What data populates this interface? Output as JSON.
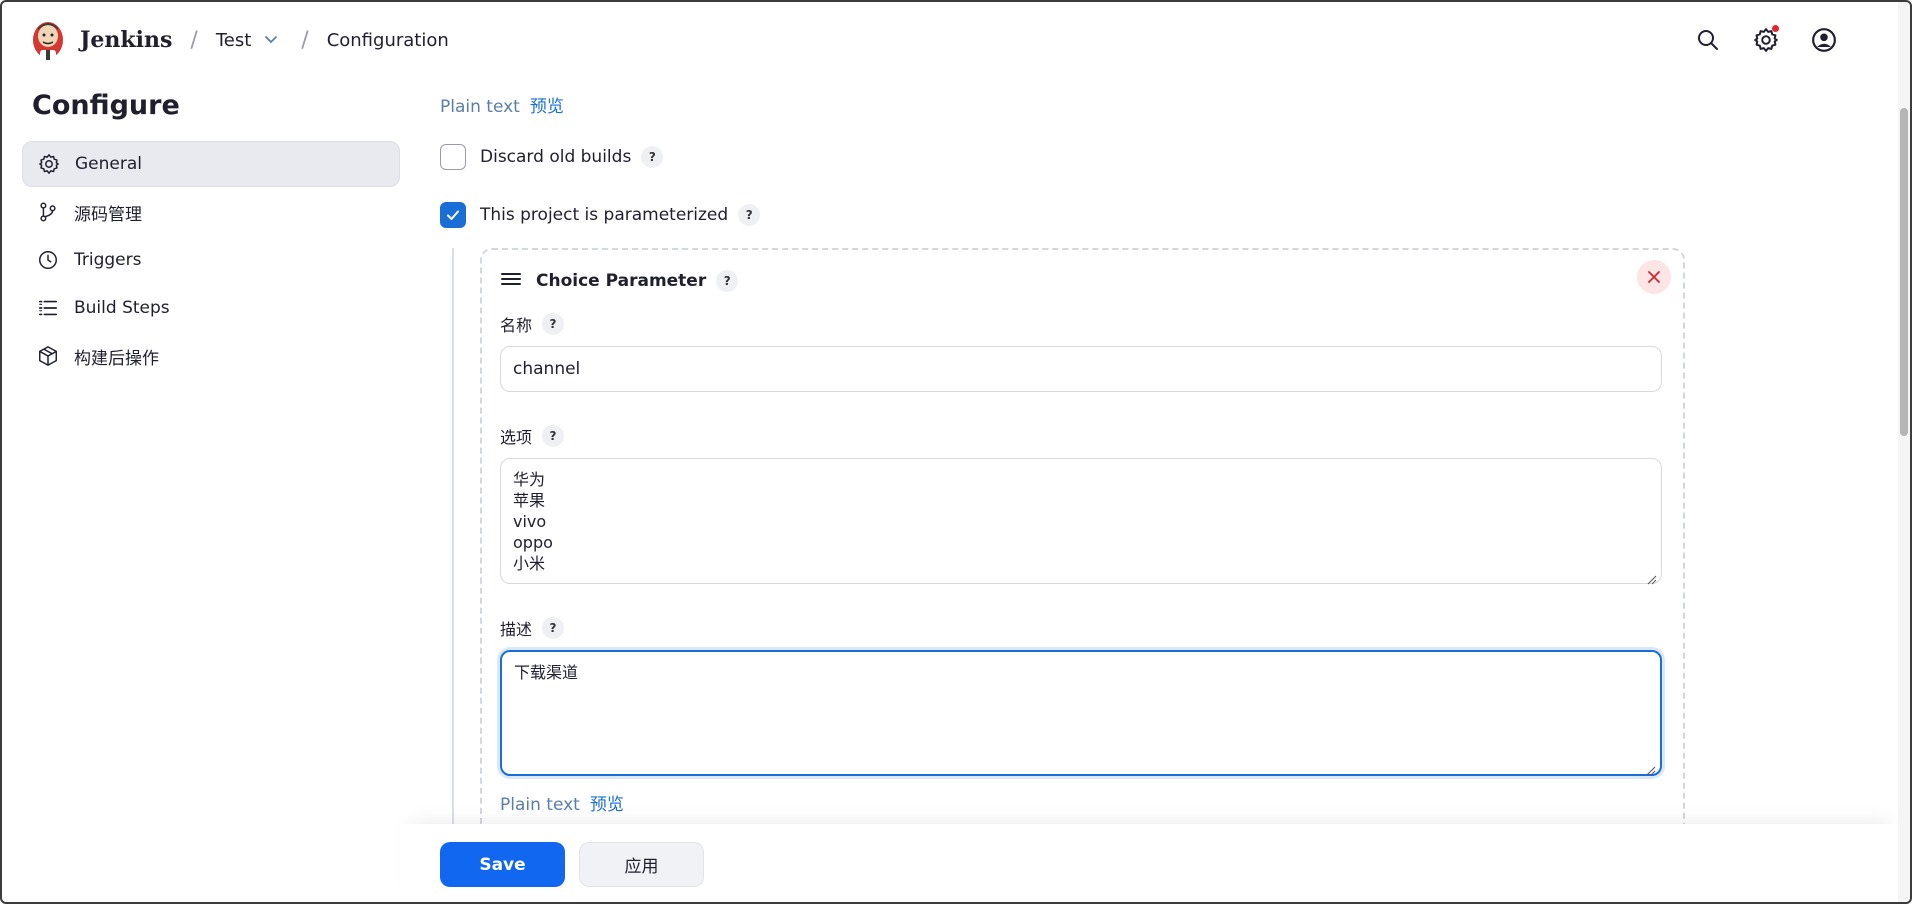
{
  "header": {
    "brand": "Jenkins",
    "breadcrumbs": [
      {
        "label": "Test",
        "has_dropdown": true
      },
      {
        "label": "Configuration"
      }
    ],
    "icons": [
      "search-icon",
      "settings-icon",
      "user-icon"
    ]
  },
  "sidebar": {
    "title": "Configure",
    "items": [
      {
        "label": "General",
        "icon": "gear-icon",
        "active": true
      },
      {
        "label": "源码管理",
        "icon": "git-branch-icon"
      },
      {
        "label": "Triggers",
        "icon": "clock-icon"
      },
      {
        "label": "Build Steps",
        "icon": "list-icon"
      },
      {
        "label": "构建后操作",
        "icon": "package-icon"
      }
    ]
  },
  "main": {
    "plain_text": "Plain text",
    "preview": "预览",
    "discard_old_builds": {
      "label": "Discard old builds",
      "checked": false
    },
    "parameterized": {
      "label": "This project is parameterized",
      "checked": true
    },
    "help": "?",
    "choice_parameter": {
      "title": "Choice Parameter",
      "name_label": "名称",
      "name_value": "channel",
      "choices_label": "选项",
      "choices": [
        "华为",
        "苹果",
        "vivo",
        "oppo",
        "小米"
      ],
      "description_label": "描述",
      "description_value": "下载渠道",
      "plain_text": "Plain text",
      "preview": "预览"
    }
  },
  "actions": {
    "save": "Save",
    "apply": "应用"
  },
  "colors": {
    "accent": "#1167f0",
    "link": "#1a6fd6",
    "notification": "#e0262f"
  }
}
